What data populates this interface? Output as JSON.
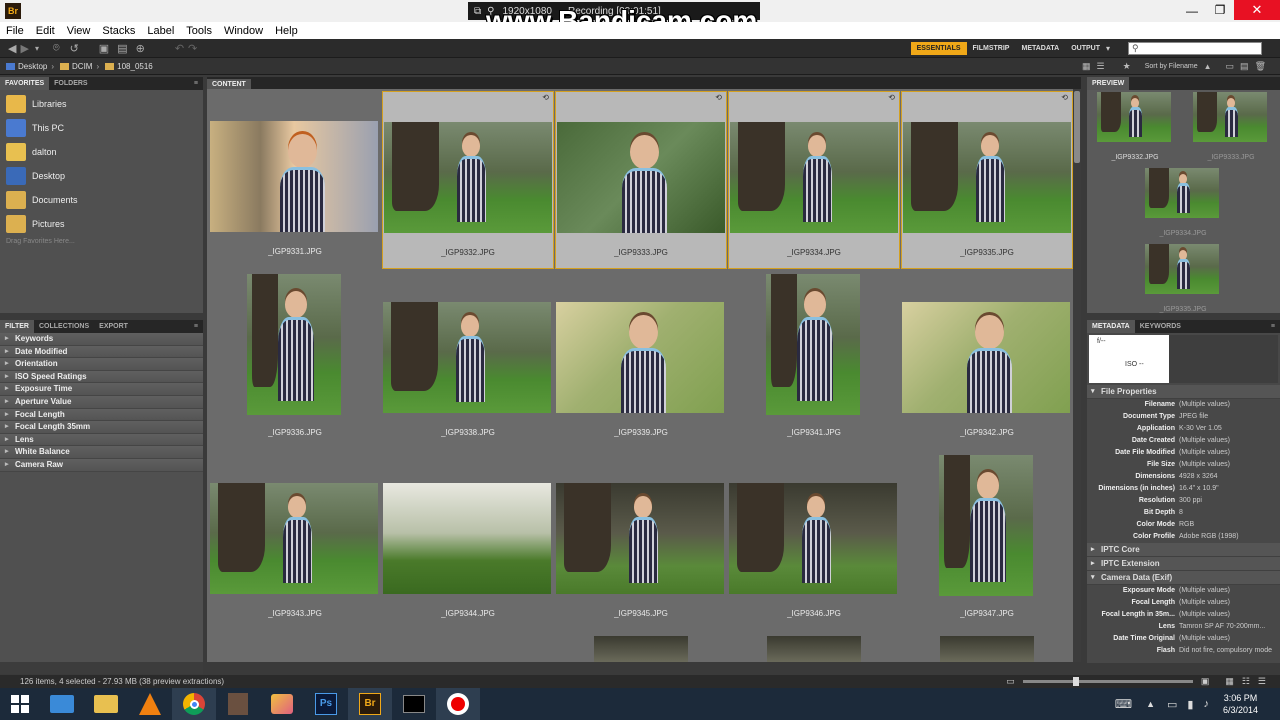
{
  "titlebar": {
    "app_badge": "Br",
    "overlay_resolution": "1920x1080",
    "overlay_recording": "Recording [00:01:51]",
    "watermark": "www.Bandicam.com"
  },
  "menu": [
    "File",
    "Edit",
    "View",
    "Stacks",
    "Label",
    "Tools",
    "Window",
    "Help"
  ],
  "workspaces": [
    "ESSENTIALS",
    "FILMSTRIP",
    "METADATA",
    "OUTPUT"
  ],
  "search": {
    "placeholder": ""
  },
  "breadcrumb": [
    "Desktop",
    "DCIM",
    "108_0516"
  ],
  "sort_label": "Sort by Filename",
  "left_tabs": [
    "FAVORITES",
    "FOLDERS"
  ],
  "favorites": [
    {
      "label": "Libraries",
      "color": "#e8b84a"
    },
    {
      "label": "This PC",
      "color": "#4a7ad0"
    },
    {
      "label": "dalton",
      "color": "#e8c050"
    },
    {
      "label": "Desktop",
      "color": "#3a6ab8"
    },
    {
      "label": "Documents",
      "color": "#dcb050"
    },
    {
      "label": "Pictures",
      "color": "#dcb050"
    }
  ],
  "favorites_hint": "Drag Favorites Here...",
  "filter_tabs": [
    "FILTER",
    "COLLECTIONS",
    "EXPORT"
  ],
  "filters": [
    "Keywords",
    "Date Modified",
    "Orientation",
    "ISO Speed Ratings",
    "Exposure Time",
    "Aperture Value",
    "Focal Length",
    "Focal Length 35mm",
    "Lens",
    "White Balance",
    "Camera Raw"
  ],
  "content_tab": "CONTENT",
  "thumbs": [
    {
      "name": "_IGP9331.JPG",
      "sel": false,
      "orient": "l",
      "tone": "indoor"
    },
    {
      "name": "_IGP9332.JPG",
      "sel": true,
      "orient": "l",
      "tone": "tree"
    },
    {
      "name": "_IGP9333.JPG",
      "sel": true,
      "orient": "l",
      "tone": "portrait"
    },
    {
      "name": "_IGP9334.JPG",
      "sel": true,
      "orient": "l",
      "tone": "tree"
    },
    {
      "name": "_IGP9335.JPG",
      "sel": true,
      "orient": "l",
      "tone": "tree"
    },
    {
      "name": "_IGP9336.JPG",
      "sel": false,
      "orient": "p",
      "tone": "tree"
    },
    {
      "name": "_IGP9338.JPG",
      "sel": false,
      "orient": "l",
      "tone": "tree"
    },
    {
      "name": "_IGP9339.JPG",
      "sel": false,
      "orient": "l",
      "tone": "bright"
    },
    {
      "name": "_IGP9341.JPG",
      "sel": false,
      "orient": "p",
      "tone": "tree"
    },
    {
      "name": "_IGP9342.JPG",
      "sel": false,
      "orient": "l",
      "tone": "bright"
    },
    {
      "name": "_IGP9343.JPG",
      "sel": false,
      "orient": "l",
      "tone": "tree"
    },
    {
      "name": "_IGP9344.JPG",
      "sel": false,
      "orient": "l",
      "tone": "field"
    },
    {
      "name": "_IGP9345.JPG",
      "sel": false,
      "orient": "l",
      "tone": "dark"
    },
    {
      "name": "_IGP9346.JPG",
      "sel": false,
      "orient": "l",
      "tone": "dark"
    },
    {
      "name": "_IGP9347.JPG",
      "sel": false,
      "orient": "p",
      "tone": "tree"
    }
  ],
  "preview_tab": "PREVIEW",
  "previews": [
    "_IGP9332.JPG",
    "_IGP9333.JPG",
    "_IGP9334.JPG",
    "_IGP9335.JPG"
  ],
  "meta_tabs": [
    "METADATA",
    "KEYWORDS"
  ],
  "meta_box": {
    "iso": "ISO --",
    "f": "f/--"
  },
  "meta_sections": {
    "file": "File Properties",
    "iptc_core": "IPTC Core",
    "iptc_ext": "IPTC Extension",
    "camera": "Camera Data (Exif)"
  },
  "file_props": [
    {
      "k": "Filename",
      "v": "(Multiple values)"
    },
    {
      "k": "Document Type",
      "v": "JPEG file"
    },
    {
      "k": "Application",
      "v": "K-30 Ver 1.05"
    },
    {
      "k": "Date Created",
      "v": "(Multiple values)"
    },
    {
      "k": "Date File Modified",
      "v": "(Multiple values)"
    },
    {
      "k": "File Size",
      "v": "(Multiple values)"
    },
    {
      "k": "Dimensions",
      "v": "4928 x 3264"
    },
    {
      "k": "Dimensions (in inches)",
      "v": "16.4\" x 10.9\""
    },
    {
      "k": "Resolution",
      "v": "300 ppi"
    },
    {
      "k": "Bit Depth",
      "v": "8"
    },
    {
      "k": "Color Mode",
      "v": "RGB"
    },
    {
      "k": "Color Profile",
      "v": "Adobe RGB (1998)"
    }
  ],
  "camera_props": [
    {
      "k": "Exposure Mode",
      "v": "(Multiple values)"
    },
    {
      "k": "Focal Length",
      "v": "(Multiple values)"
    },
    {
      "k": "Focal Length in 35m...",
      "v": "(Multiple values)"
    },
    {
      "k": "Lens",
      "v": "Tamron SP AF 70-200mm..."
    },
    {
      "k": "Date Time Original",
      "v": "(Multiple values)"
    },
    {
      "k": "Flash",
      "v": "Did not fire, compulsory mode"
    }
  ],
  "status": "126 items, 4 selected - 27.93 MB (38 preview extractions)",
  "clock": {
    "time": "3:06 PM",
    "date": "6/3/2014"
  },
  "colors": {
    "accent": "#f0a818",
    "sel_border": "#d4a020"
  }
}
